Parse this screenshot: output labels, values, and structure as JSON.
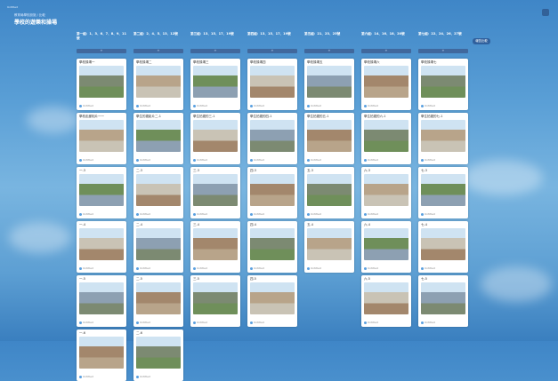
{
  "app": {
    "small_label": "Untitled",
    "breadcrumb": "教育局學校設施 / 比較",
    "title": "學校的遊樂和操場",
    "compare_label": "報告比較"
  },
  "columns": [
    {
      "heading": "第一組：1、3、6、7、8、9、11號",
      "bar": "+",
      "cards": [
        "學校操場一",
        "學校走廊相片一一",
        "一-3",
        "一-4",
        "一-5",
        "一-6"
      ]
    },
    {
      "heading": "第二組：2、4、5、13、12號",
      "bar": "+",
      "cards": [
        "學校操場二",
        "學生的攝影片二-1",
        "二-3",
        "二-4",
        "二-5",
        "二-6"
      ]
    },
    {
      "heading": "第三組：13、15、17、19號",
      "bar": "+",
      "cards": [
        "學校操場三",
        "學生拍攝的三-1",
        "三-3",
        "三-4",
        "三-5"
      ]
    },
    {
      "heading": "第四組：13、15、17、19號",
      "bar": "+",
      "cards": [
        "學校操場四",
        "學生拍攝的四-1",
        "四-3",
        "四-4",
        "四-5"
      ]
    },
    {
      "heading": "第五組：21、23、25號",
      "bar": "+",
      "cards": [
        "學校操場五",
        "學生拍攝的五-1",
        "五-3",
        "五-4"
      ]
    },
    {
      "heading": "第六組：14、16、18、20號",
      "bar": "+",
      "cards": [
        "學校操場六",
        "學生拍攝的六-1",
        "六-3",
        "六-4",
        "六-5"
      ]
    },
    {
      "heading": "第七組：22、24、26、27號",
      "bar": "+",
      "cards": [
        "學校操場七",
        "學生拍攝的七-1",
        "七-3",
        "七-4",
        "七-5"
      ]
    }
  ],
  "card_footer": "Untitled",
  "photo_palette": [
    "#7c8a72",
    "#b8a48a",
    "#6f8f5a",
    "#c9c3b5",
    "#8da0b2",
    "#a3876c"
  ]
}
